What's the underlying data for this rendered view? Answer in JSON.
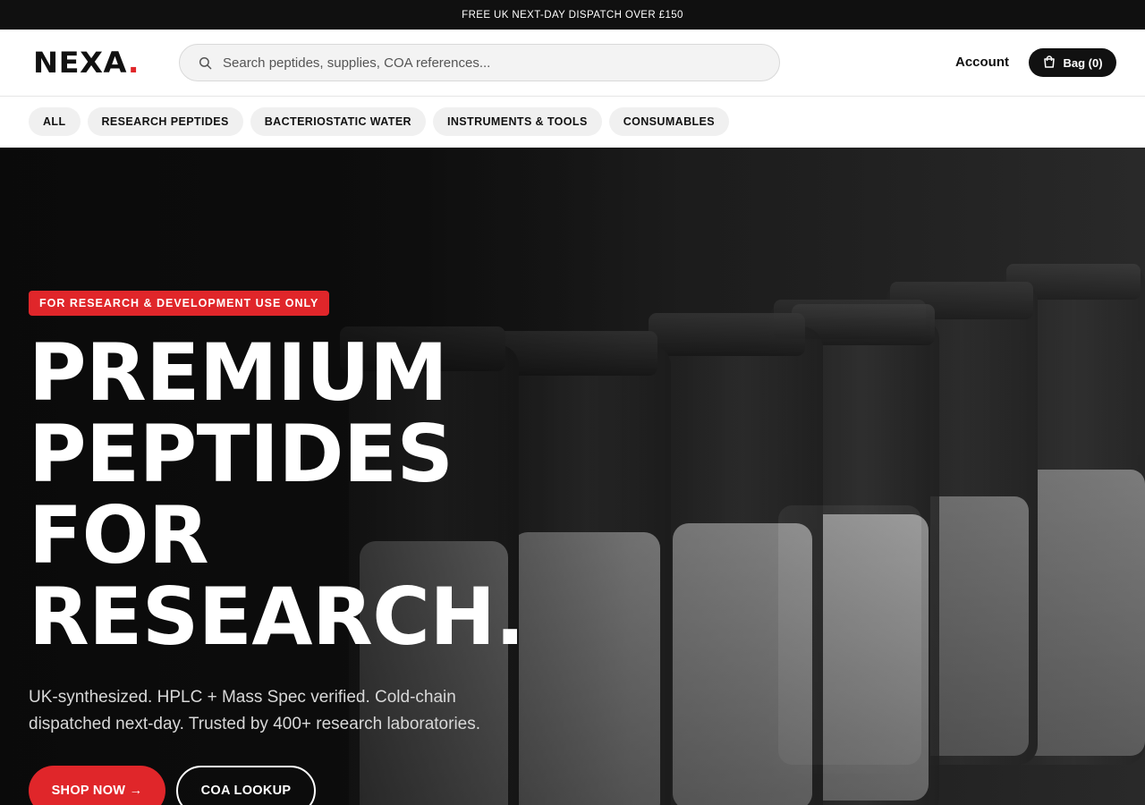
{
  "announcement": "FREE UK NEXT-DAY DISPATCH OVER £150",
  "header": {
    "logo_text": "NEXA",
    "logo_dot": ".",
    "search_placeholder": "Search peptides, supplies, COA references...",
    "account_label": "Account",
    "bag_label": "Bag (0)"
  },
  "categories": [
    {
      "label": "ALL"
    },
    {
      "label": "RESEARCH PEPTIDES"
    },
    {
      "label": "BACTERIOSTATIC WATER"
    },
    {
      "label": "INSTRUMENTS & TOOLS"
    },
    {
      "label": "CONSUMABLES"
    }
  ],
  "hero": {
    "badge": "FOR RESEARCH & DEVELOPMENT USE ONLY",
    "headline_lines": [
      "PREMIUM",
      "PEPTIDES",
      "FOR",
      "RESEARCH."
    ],
    "subtitle": "UK-synthesized. HPLC + Mass Spec verified. Cold-chain dispatched next-day. Trusted by 400+ research laboratories.",
    "primary_cta": "SHOP NOW →",
    "secondary_cta": "COA LOOKUP"
  },
  "colors": {
    "accent": "#e0262a",
    "dark": "#101010"
  },
  "icons": {
    "search": "search-icon",
    "bag": "shopping-bag-icon"
  }
}
